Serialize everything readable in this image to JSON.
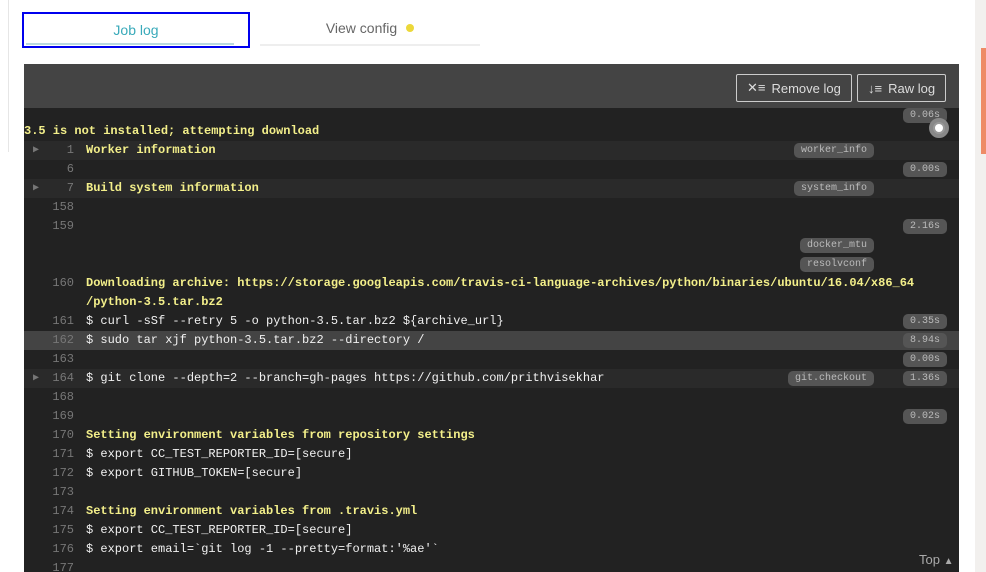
{
  "tabs": [
    {
      "label": "Job log"
    },
    {
      "label": "View config"
    }
  ],
  "toolbar": {
    "remove": "Remove log",
    "raw": "Raw log"
  },
  "top_label": "Top",
  "colors": {
    "accent": "#39aaba",
    "config_dot": "#ecd83a",
    "scroll_thumb": "#ee8b66"
  },
  "rows": [
    {
      "num": "",
      "text": "",
      "dur": "0.06s"
    },
    {
      "num": "",
      "text": "3.5 is not installed; attempting download",
      "y": true,
      "flush": true
    },
    {
      "num": "1",
      "text": "Worker information",
      "y": true,
      "fold": true,
      "tag": "worker_info"
    },
    {
      "num": "6",
      "text": "",
      "dur": "0.00s"
    },
    {
      "num": "7",
      "text": "Build system information",
      "y": true,
      "fold": true,
      "tag": "system_info"
    },
    {
      "num": "158",
      "text": ""
    },
    {
      "num": "159",
      "text": "",
      "dur": "2.16s"
    },
    {
      "num": "",
      "text": "",
      "tag": "docker_mtu"
    },
    {
      "num": "",
      "text": "",
      "tag": "resolvconf"
    },
    {
      "num": "160",
      "text": "Downloading archive: https://storage.googleapis.com/travis-ci-language-archives/python/binaries/ubuntu/16.04/x86_64",
      "y": true
    },
    {
      "num": "",
      "text": "/python-3.5.tar.bz2",
      "y": true
    },
    {
      "num": "161",
      "text": "$ curl -sSf --retry 5 -o python-3.5.tar.bz2 ${archive_url}",
      "dur": "0.35s"
    },
    {
      "num": "162",
      "text": "$ sudo tar xjf python-3.5.tar.bz2 --directory /",
      "dur": "8.94s",
      "hl": true
    },
    {
      "num": "163",
      "text": "",
      "dur": "0.00s"
    },
    {
      "num": "164",
      "text": "$ git clone --depth=2 --branch=gh-pages https://github.com/prithvisekhar",
      "fold": true,
      "tag": "git.checkout",
      "dur": "1.36s"
    },
    {
      "num": "168",
      "text": ""
    },
    {
      "num": "169",
      "text": "",
      "dur": "0.02s"
    },
    {
      "num": "170",
      "text": "Setting environment variables from repository settings",
      "y": true
    },
    {
      "num": "171",
      "text": "$ export CC_TEST_REPORTER_ID=[secure]"
    },
    {
      "num": "172",
      "text": "$ export GITHUB_TOKEN=[secure]"
    },
    {
      "num": "173",
      "text": ""
    },
    {
      "num": "174",
      "text": "Setting environment variables from .travis.yml",
      "y": true
    },
    {
      "num": "175",
      "text": "$ export CC_TEST_REPORTER_ID=[secure]"
    },
    {
      "num": "176",
      "text": "$ export email=`git log -1 --pretty=format:'%ae'`"
    },
    {
      "num": "177",
      "text": ""
    }
  ]
}
